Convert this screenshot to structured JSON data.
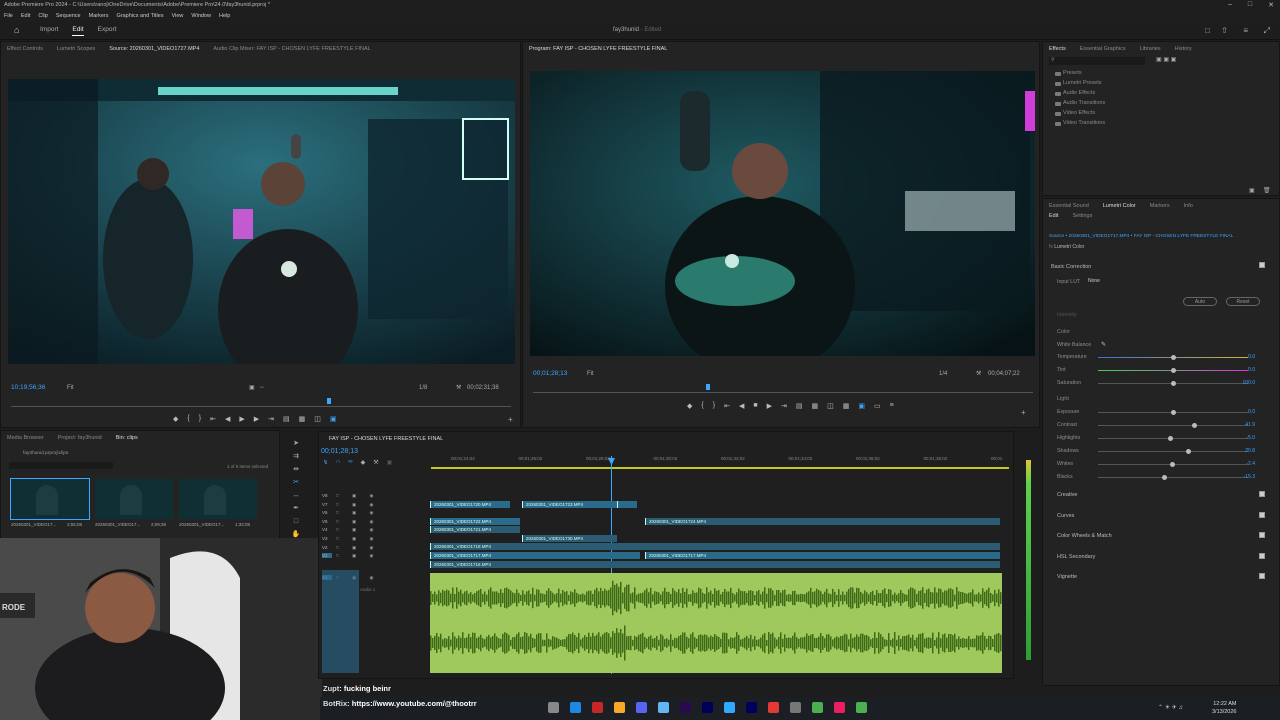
{
  "window": {
    "title": "Adobe Premiere Pro 2024 - C:\\Users\\ranoj\\OneDrive\\Documents\\Adobe\\Premiere Pro\\24.0\\fay3hunid.prproj *",
    "menus": [
      "File",
      "Edit",
      "Clip",
      "Sequence",
      "Markers",
      "Graphics and Titles",
      "View",
      "Window",
      "Help"
    ]
  },
  "header": {
    "workspaces": [
      "Import",
      "Edit",
      "Export"
    ],
    "active_workspace": "Edit",
    "project_name": "fay3hunid",
    "edited_label": "- Edited"
  },
  "source_monitor": {
    "tabs": [
      "Effect Controls",
      "Lumetri Scopes",
      "Source: 20260301_VIDEO1727.MP4",
      "Audio Clip Mixer: FAY ISP - CHOSEN LYFE FREESTYLE FINAL"
    ],
    "timecode": "10;19;56;36",
    "fit": "Fit",
    "resolution": "1/8",
    "duration": "00;02;31;38"
  },
  "program_monitor": {
    "tab": "Program: FAY ISP - CHOSEN LYFE FREESTYLE FINAL",
    "timecode": "00;01;28;13",
    "fit": "Fit",
    "resolution": "1/4",
    "duration": "00;04;07;22"
  },
  "effects_panel": {
    "tabs": [
      "Effects",
      "Essential Graphics",
      "Libraries",
      "History"
    ],
    "items": [
      "Presets",
      "Lumetri Presets",
      "Audio Effects",
      "Audio Transitions",
      "Video Effects",
      "Video Transitions"
    ]
  },
  "lumetri": {
    "tabs": [
      "Essential Sound",
      "Lumetri Color",
      "Markers",
      "Info"
    ],
    "subtabs": [
      "Edit",
      "Settings"
    ],
    "source_line": "Source • 20260301_VIDEO1717.MP4 • FAY ISP - CHOSEN LYFE FREESTYLE FINAL",
    "fx_label": "Lumetri Color",
    "basic_correction": "Basic Correction",
    "input_lut_label": "Input LUT",
    "input_lut_value": "None",
    "auto_label": "Auto",
    "reset_label": "Reset",
    "intensity_label": "Intensity",
    "color_header": "Color",
    "white_balance": "White Balance",
    "light_header": "Light",
    "color_controls": [
      {
        "label": "Temperature",
        "value": "0.0",
        "pos": 0.5
      },
      {
        "label": "Tint",
        "value": "0.0",
        "pos": 0.5
      },
      {
        "label": "Saturation",
        "value": "100.0",
        "pos": 0.5
      }
    ],
    "light_controls": [
      {
        "label": "Exposure",
        "value": "0.0",
        "pos": 0.5
      },
      {
        "label": "Contrast",
        "value": "41.9",
        "pos": 0.64
      },
      {
        "label": "Highlights",
        "value": "-5.0",
        "pos": 0.48
      },
      {
        "label": "Shadows",
        "value": "20.8",
        "pos": 0.6
      },
      {
        "label": "Whites",
        "value": "-2.4",
        "pos": 0.49
      },
      {
        "label": "Blacks",
        "value": "-15.3",
        "pos": 0.44
      }
    ],
    "sections": [
      "Creative",
      "Curves",
      "Color Wheels & Match",
      "HSL Secondary",
      "Vignette"
    ]
  },
  "project_panel": {
    "tabs": [
      "Media Browser",
      "Project: fay3hunid",
      "Bin: clips"
    ],
    "path": "fay3hunid.prproj\\clips",
    "selection": "1 of 9 items selected",
    "thumbs": [
      {
        "name": "20260301_VIDEO17...",
        "duration": "2;55;08"
      },
      {
        "name": "20260301_VIDEO17...",
        "duration": "2;09;38"
      },
      {
        "name": "20260301_VIDEO17...",
        "duration": "1;32;08"
      }
    ]
  },
  "timeline": {
    "tab": "FAY ISP - CHOSEN LYFE FREESTYLE FINAL",
    "timecode": "00;01;28;13",
    "ruler": [
      "00;01;24;02",
      "00;01;26;02",
      "00;01;28;02",
      "00;01;30;02",
      "00;01;32;02",
      "00;01;34;02",
      "00;01;36;02",
      "00;01;38;02",
      "00;01"
    ],
    "tracks": [
      "V8",
      "V7",
      "V6",
      "V5",
      "V4",
      "V3",
      "V2",
      "V1",
      "A1"
    ],
    "audio_label": "Audio 1",
    "clips": [
      "20260301_VIDEO1720.MP4",
      "20260301_VIDEO1723.MP4",
      "20260301_VIDEO1722.MP4",
      "20260301_VIDEO1724.MP4",
      "20260301_VIDEO1721.MP4",
      "20260301_VIDEO1730.MP4",
      "20260301_VIDEO1718.MP4",
      "20260301_VIDEO1717.MP4",
      "20260301_VIDEO1717.MP4",
      "20260301_VIDEO1716.MP4"
    ]
  },
  "chat": {
    "line1_user": "Zupt",
    "line1_msg": ": fucking beinr",
    "line2_user": "BotRix",
    "line2_msg": ": https://www.youtube.com/@thootrr"
  },
  "taskbar": {
    "time": "12:22 AM",
    "date": "3/13/2026"
  }
}
